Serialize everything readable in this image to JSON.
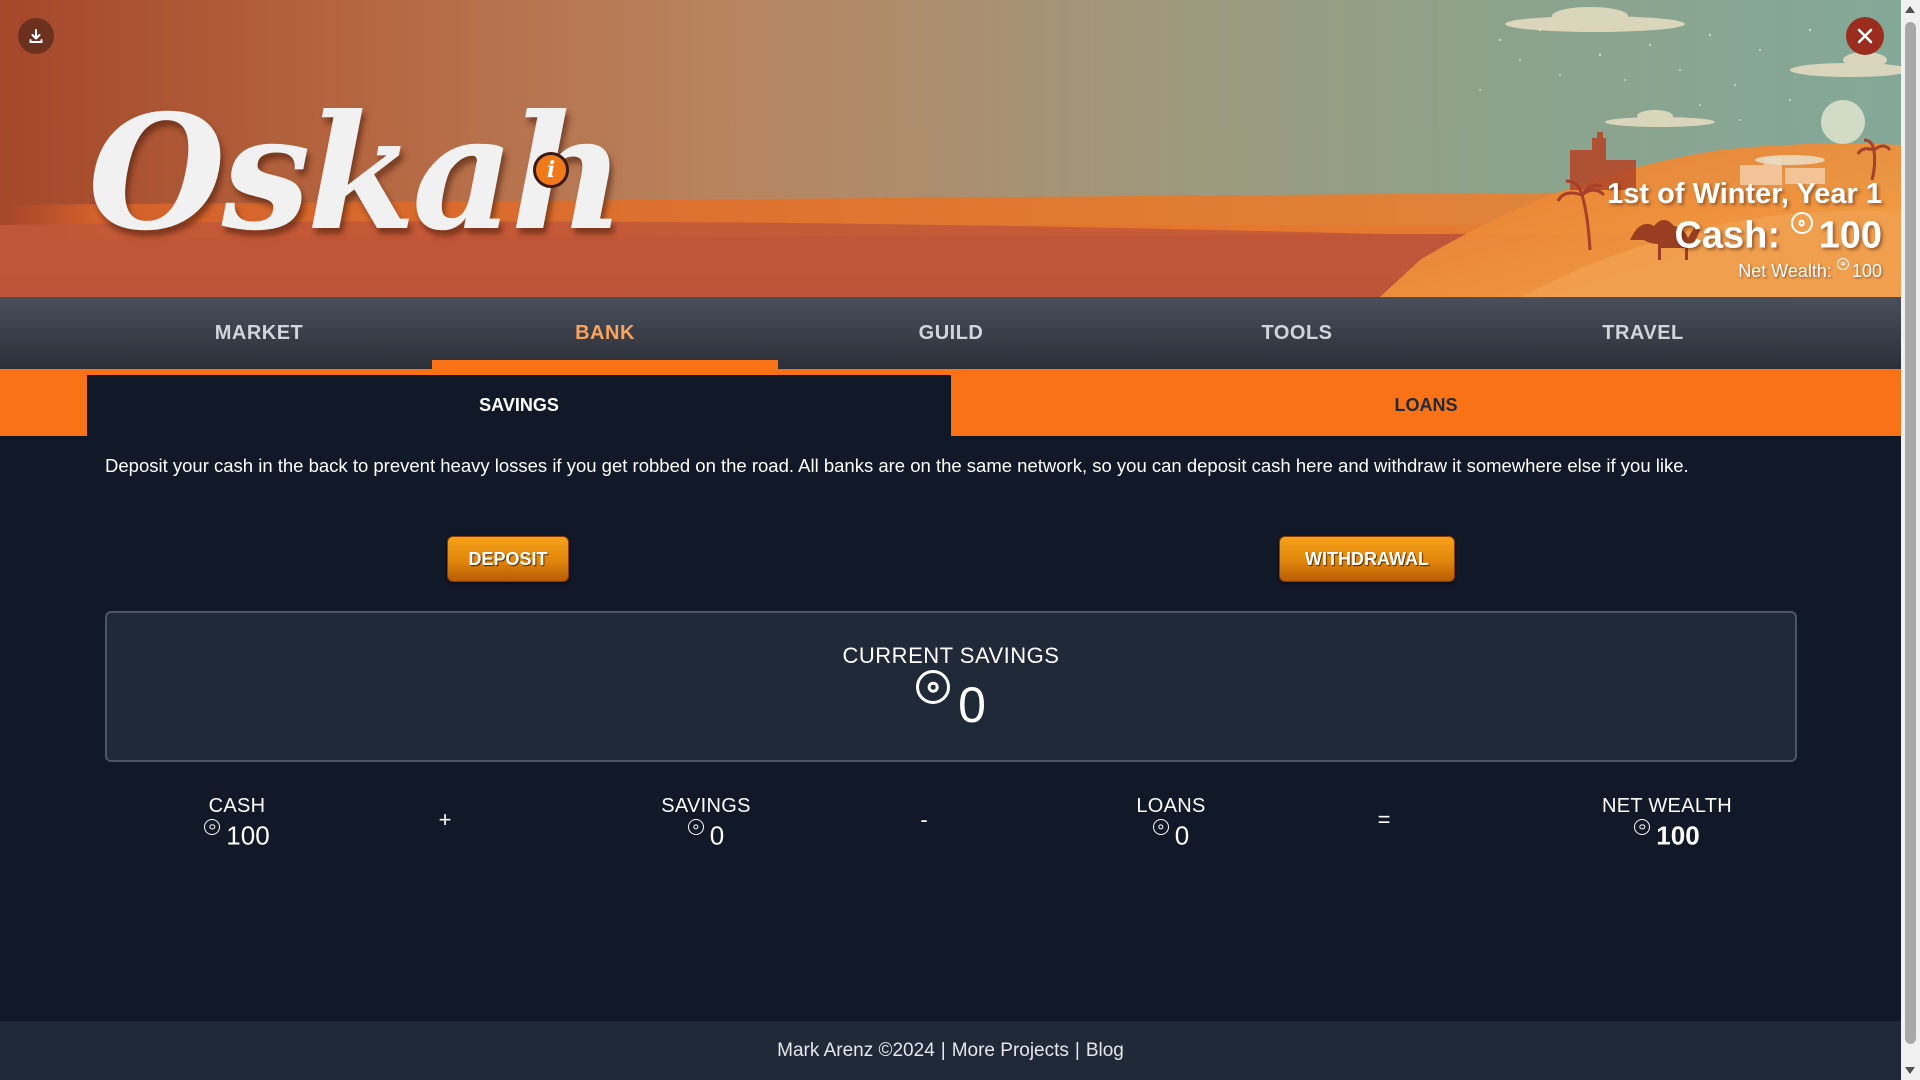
{
  "header": {
    "logo_text": "Oskah",
    "info_icon": "info-icon",
    "download_icon": "download-icon",
    "close_icon": "close-icon",
    "date": "1st of Winter, Year 1",
    "cash_label": "Cash:",
    "cash_value": "100",
    "net_wealth_label": "Net Wealth:",
    "net_wealth_value": "100",
    "currency_icon": "coin-icon"
  },
  "main_nav": {
    "tabs": [
      {
        "label": "MARKET",
        "active": false
      },
      {
        "label": "BANK",
        "active": true
      },
      {
        "label": "GUILD",
        "active": false
      },
      {
        "label": "TOOLS",
        "active": false
      },
      {
        "label": "TRAVEL",
        "active": false
      }
    ]
  },
  "sub_nav": {
    "tabs": [
      {
        "label": "SAVINGS",
        "active": true
      },
      {
        "label": "LOANS",
        "active": false
      }
    ]
  },
  "savings": {
    "description": "Deposit your cash in the back to prevent heavy losses if you get robbed on the road. All banks are on the same network, so you can deposit cash here and withdraw it somewhere else if you like.",
    "deposit_label": "DEPOSIT",
    "withdrawal_label": "WITHDRAWAL",
    "current_savings_label": "CURRENT SAVINGS",
    "current_savings_value": "0"
  },
  "summary": {
    "cash": {
      "label": "CASH",
      "value": "100"
    },
    "op1": "+",
    "savings": {
      "label": "SAVINGS",
      "value": "0"
    },
    "op2": "-",
    "loans": {
      "label": "LOANS",
      "value": "0"
    },
    "op3": "=",
    "net_wealth": {
      "label": "NET WEALTH",
      "value": "100"
    }
  },
  "footer": {
    "author": "Mark Arenz ©2024",
    "separator": "|",
    "more_projects": "More Projects",
    "blog": "Blog"
  },
  "colors": {
    "accent": "#f97316",
    "active_tab_text": "#f9a35c",
    "background": "#111827",
    "panel": "#1f2937",
    "button": "#e0850b"
  }
}
